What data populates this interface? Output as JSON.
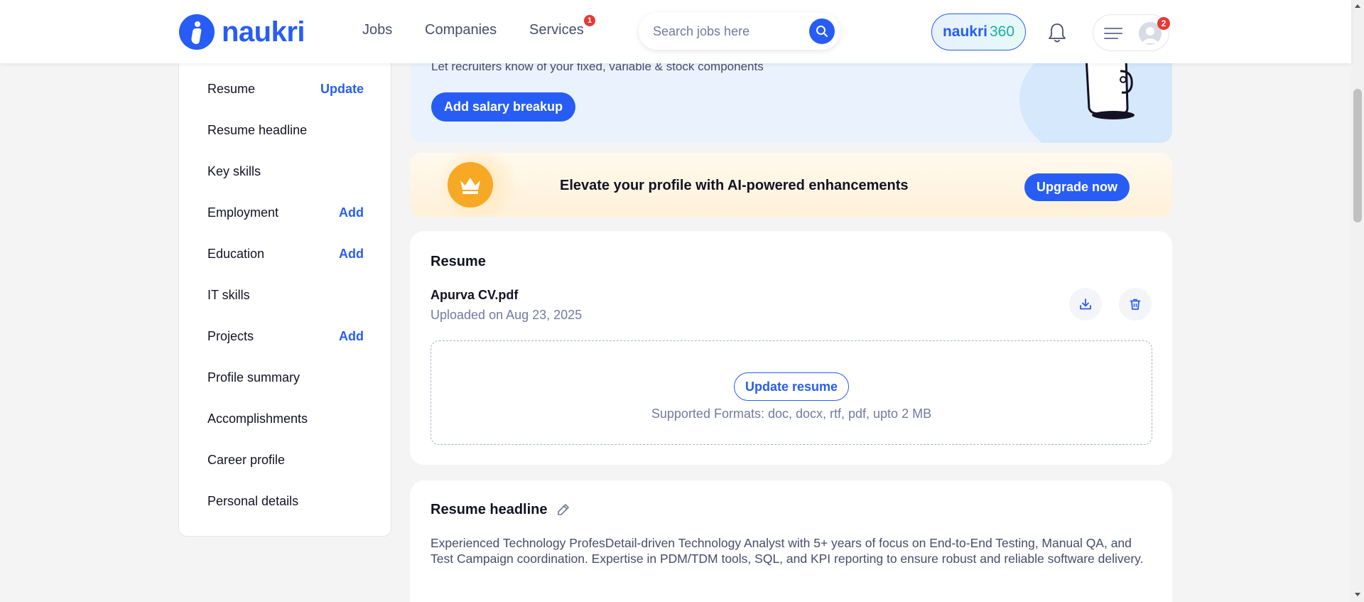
{
  "header": {
    "logo_text": "naukri",
    "nav": [
      {
        "label": "Jobs"
      },
      {
        "label": "Companies"
      },
      {
        "label": "Services",
        "badge": "1"
      }
    ],
    "search": {
      "placeholder": "Search jobs here"
    },
    "naukri360": {
      "part1": "naukri",
      "part2": "360"
    },
    "menu_badge": "2",
    "icons": [
      "search-icon",
      "bell-icon",
      "hamburger-icon",
      "avatar-icon"
    ]
  },
  "sidebar": {
    "items": [
      {
        "label": "Resume",
        "action": "Update"
      },
      {
        "label": "Resume headline",
        "action": ""
      },
      {
        "label": "Key skills",
        "action": ""
      },
      {
        "label": "Employment",
        "action": "Add"
      },
      {
        "label": "Education",
        "action": "Add"
      },
      {
        "label": "IT skills",
        "action": ""
      },
      {
        "label": "Projects",
        "action": "Add"
      },
      {
        "label": "Profile summary",
        "action": ""
      },
      {
        "label": "Accomplishments",
        "action": ""
      },
      {
        "label": "Career profile",
        "action": ""
      },
      {
        "label": "Personal details",
        "action": ""
      }
    ]
  },
  "salary": {
    "subtitle": "Let recruiters know of your fixed, variable & stock components",
    "button": "Add salary breakup"
  },
  "upgrade": {
    "text": "Elevate your profile with AI-powered enhancements",
    "button": "Upgrade now"
  },
  "resume": {
    "title": "Resume",
    "file_name": "Apurva CV.pdf",
    "uploaded": "Uploaded on Aug 23, 2025",
    "update_button": "Update resume",
    "formats": "Supported Formats: doc, docx, rtf, pdf, upto 2 MB"
  },
  "headline": {
    "title": "Resume headline",
    "text": "Experienced Technology ProfesDetail-driven Technology Analyst with 5+ years of focus on End-to-End Testing, Manual QA, and Test Campaign coordination. Expertise in PDM/TDM tools, SQL, and KPI reporting to ensure robust and reliable software delivery."
  },
  "colors": {
    "brand": "#275df5",
    "badge": "#e53935",
    "crown": "#f7a824"
  }
}
